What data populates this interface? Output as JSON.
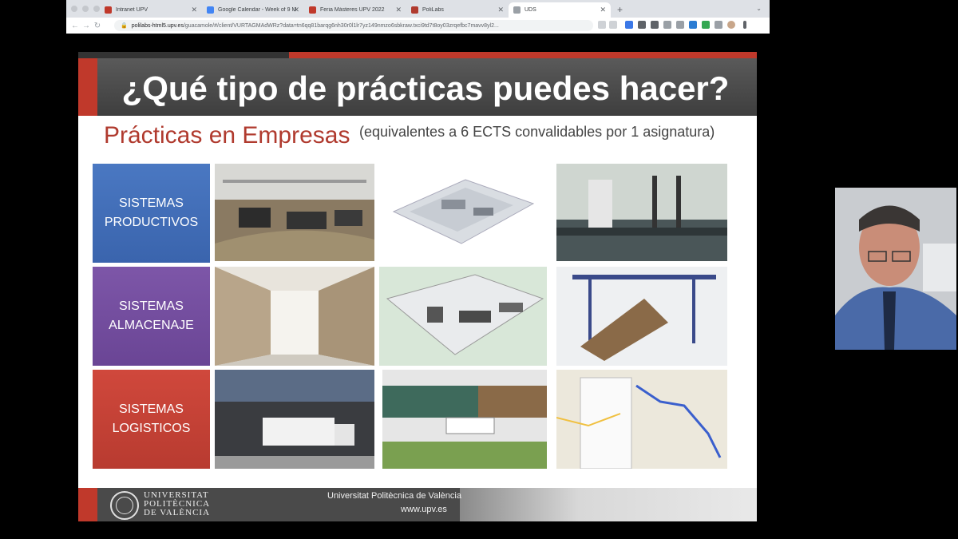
{
  "browser": {
    "tabs": [
      {
        "label": "Intranet UPV",
        "color": "#c0392b",
        "active": false
      },
      {
        "label": "Google Calendar - Week of 9 M",
        "color": "#4285f4",
        "active": false
      },
      {
        "label": "Feria Másteres UPV 2022",
        "color": "#c0392b",
        "active": false
      },
      {
        "label": "PoliLabs",
        "color": "#b03a2e",
        "active": false
      },
      {
        "label": "UDS",
        "color": "#9aa0a6",
        "active": true
      }
    ],
    "new_tab": "+",
    "url_host": "polilabs-html5.upv.es",
    "url_rest": "/guacamole/#/client/VURTAGMAdWRz?data=tn6qq81barqg6nh30r0l1lr7yz149nmzo6sbkraw.txci9td7t8oy03zrqefbc7mavv8yl2..."
  },
  "slide": {
    "title": "¿Qué tipo de prácticas puedes hacer?",
    "subtitle": "Prácticas en Empresas",
    "subnote": "(equivalentes a 6 ECTS convalidables por 1 asignatura)",
    "categories": [
      {
        "line1": "SISTEMAS",
        "line2": "PRODUCTIVOS",
        "color": "#4a78c2"
      },
      {
        "line1": "SISTEMAS",
        "line2": "ALMACENAJE",
        "color": "#7d56a8"
      },
      {
        "line1": "SISTEMAS",
        "line2": "LOGISTICOS",
        "color": "#d0483c"
      }
    ],
    "footer": {
      "logo_lines": [
        "UNIVERSITAT",
        "POLITÈCNICA",
        "DE VALÈNCIA"
      ],
      "org": "Universitat Politècnica de València",
      "web": "www.upv.es"
    }
  }
}
